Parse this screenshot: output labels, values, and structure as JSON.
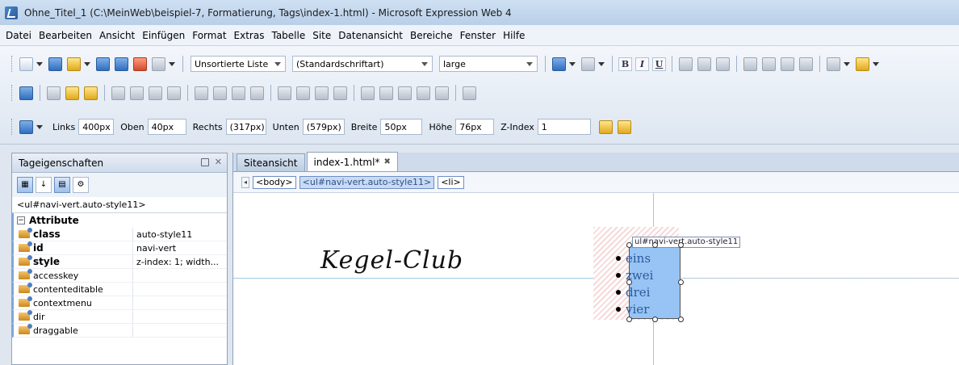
{
  "window": {
    "title": "Ohne_Titel_1 (C:\\MeinWeb\\beispiel-7, Formatierung, Tags\\index-1.html) - Microsoft Expression Web 4"
  },
  "menu": [
    "Datei",
    "Bearbeiten",
    "Ansicht",
    "Einfügen",
    "Format",
    "Extras",
    "Tabelle",
    "Site",
    "Datenansicht",
    "Bereiche",
    "Fenster",
    "Hilfe"
  ],
  "toolbar": {
    "style_combo": "Unsortierte Liste",
    "font_combo": "(Standardschriftart)",
    "size_combo": "large",
    "bold": "B",
    "italic": "I",
    "underline": "U"
  },
  "position_bar": {
    "links_label": "Links",
    "links_value": "400px",
    "oben_label": "Oben",
    "oben_value": "40px",
    "rechts_label": "Rechts",
    "rechts_value": "(317px)",
    "unten_label": "Unten",
    "unten_value": "(579px)",
    "breite_label": "Breite",
    "breite_value": "50px",
    "hoehe_label": "Höhe",
    "hoehe_value": "76px",
    "zindex_label": "Z-Index",
    "zindex_value": "1"
  },
  "panel": {
    "title": "Tageigenschaften",
    "selected_tag": "<ul#navi-vert.auto-style11>",
    "section": "Attribute",
    "rows": [
      {
        "name": "class",
        "value": "auto-style11",
        "bold": true
      },
      {
        "name": "id",
        "value": "navi-vert",
        "bold": true
      },
      {
        "name": "style",
        "value": "z-index: 1; width...",
        "bold": true
      },
      {
        "name": "accesskey",
        "value": ""
      },
      {
        "name": "contenteditable",
        "value": ""
      },
      {
        "name": "contextmenu",
        "value": ""
      },
      {
        "name": "dir",
        "value": ""
      },
      {
        "name": "draggable",
        "value": ""
      }
    ]
  },
  "editor": {
    "tabs": [
      {
        "label": "Siteansicht",
        "active": false
      },
      {
        "label": "index-1.html*",
        "active": true
      }
    ],
    "breadcrumbs": [
      "<body>",
      "<ul#navi-vert.auto-style11>",
      "<li>"
    ],
    "logo": "Kegel-Club",
    "selection_label": "ul#navi-vert.auto-style11",
    "list_items": [
      "eins",
      "zwei",
      "drei",
      "vier"
    ]
  }
}
